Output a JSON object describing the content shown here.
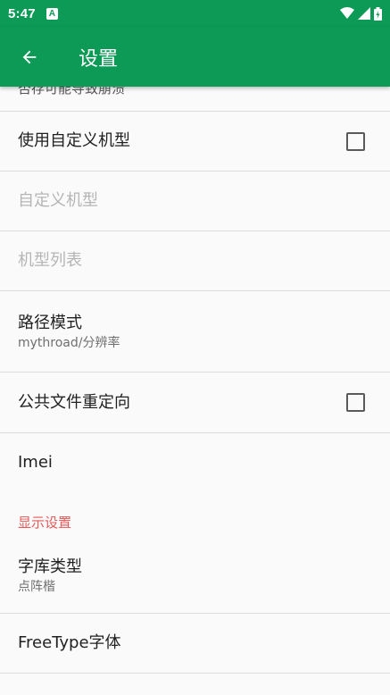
{
  "status_bar": {
    "time": "5:47",
    "notification_letter": "A",
    "icons": [
      "wifi-icon",
      "cell-signal-icon",
      "battery-icon"
    ]
  },
  "app_bar": {
    "title": "设置",
    "back_icon": "arrow-back-icon"
  },
  "settings": {
    "clipped_summary": "否存可能导致崩溃",
    "use_custom_model": {
      "title": "使用自定义机型",
      "checked": false
    },
    "custom_model": {
      "title": "自定义机型",
      "enabled": false
    },
    "model_list": {
      "title": "机型列表",
      "enabled": false
    },
    "path_mode": {
      "title": "路径模式",
      "summary": "mythroad/分辨率"
    },
    "public_file_redirect": {
      "title": "公共文件重定向",
      "checked": false
    },
    "imei": {
      "title": "Imei"
    },
    "display_category": "显示设置",
    "font_type": {
      "title": "字库类型",
      "summary": "点阵楷"
    },
    "freetype_font": {
      "title": "FreeType字体"
    }
  },
  "colors": {
    "primary": "#0d9a56",
    "category_accent": "#e35a5a",
    "background": "#fafafa"
  }
}
